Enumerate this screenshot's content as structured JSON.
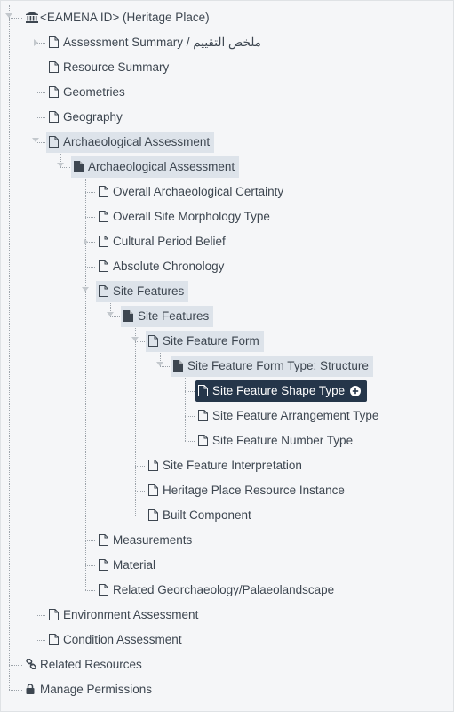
{
  "tree": {
    "nodes": [
      {
        "label": "<EAMENA ID> (Heritage Place)",
        "level": 0,
        "icon": "institution-icon",
        "expanded": true
      },
      {
        "label": "Assessment Summary / ملخص التقييم",
        "level": 1,
        "icon": "file-outline-icon",
        "collapsed_caret": true
      },
      {
        "label": "Resource Summary",
        "level": 1,
        "icon": "file-outline-icon"
      },
      {
        "label": "Geometries",
        "level": 1,
        "icon": "file-outline-icon"
      },
      {
        "label": "Geography",
        "level": 1,
        "icon": "file-outline-icon"
      },
      {
        "label": "Archaeological Assessment",
        "level": 1,
        "icon": "file-outline-icon",
        "highlighted": true,
        "expanded": true
      },
      {
        "label": "Archaeological Assessment",
        "level": 2,
        "icon": "file-solid-icon",
        "highlighted": true,
        "expanded": true
      },
      {
        "label": "Overall Archaeological Certainty",
        "level": 3,
        "icon": "file-outline-icon"
      },
      {
        "label": "Overall Site Morphology Type",
        "level": 3,
        "icon": "file-outline-icon"
      },
      {
        "label": "Cultural Period Belief",
        "level": 3,
        "icon": "file-outline-icon",
        "collapsed_caret": true
      },
      {
        "label": "Absolute Chronology",
        "level": 3,
        "icon": "file-outline-icon"
      },
      {
        "label": "Site Features",
        "level": 3,
        "icon": "file-outline-icon",
        "highlighted": true,
        "expanded": true
      },
      {
        "label": "Site Features",
        "level": 4,
        "icon": "file-solid-icon",
        "highlighted": true,
        "expanded": true
      },
      {
        "label": "Site Feature Form",
        "level": 5,
        "icon": "file-outline-icon",
        "highlighted": true,
        "expanded": true
      },
      {
        "label": "Site Feature Form Type: Structure",
        "level": 6,
        "icon": "file-solid-icon",
        "highlighted": true,
        "expanded": true
      },
      {
        "label": "Site Feature Shape Type",
        "level": 7,
        "icon": "file-outline-icon",
        "selected": true
      },
      {
        "label": "Site Feature Arrangement Type",
        "level": 7,
        "icon": "file-outline-icon"
      },
      {
        "label": "Site Feature Number Type",
        "level": 7,
        "icon": "file-outline-icon"
      },
      {
        "label": "Site Feature Interpretation",
        "level": 5,
        "icon": "file-outline-icon"
      },
      {
        "label": "Heritage Place Resource Instance",
        "level": 5,
        "icon": "file-outline-icon"
      },
      {
        "label": "Built Component",
        "level": 5,
        "icon": "file-outline-icon"
      },
      {
        "label": "Measurements",
        "level": 3,
        "icon": "file-outline-icon"
      },
      {
        "label": "Material",
        "level": 3,
        "icon": "file-outline-icon"
      },
      {
        "label": "Related Georchaeology/Palaeolandscape",
        "level": 3,
        "icon": "file-outline-icon"
      },
      {
        "label": "Environment Assessment",
        "level": 1,
        "icon": "file-outline-icon"
      },
      {
        "label": "Condition Assessment",
        "level": 1,
        "icon": "file-outline-icon"
      },
      {
        "label": "Related Resources",
        "level": 0,
        "icon": "link-icon"
      },
      {
        "label": "Manage Permissions",
        "level": 0,
        "icon": "lock-icon"
      }
    ],
    "selected_action_icon": "plus-circle-icon"
  },
  "colors": {
    "background": "#f5f6f8",
    "text": "#3d4650",
    "highlight": "#dde3ea",
    "selected": "#25364a",
    "selected_text": "#ffffff",
    "connector": "#9ca3aa"
  }
}
